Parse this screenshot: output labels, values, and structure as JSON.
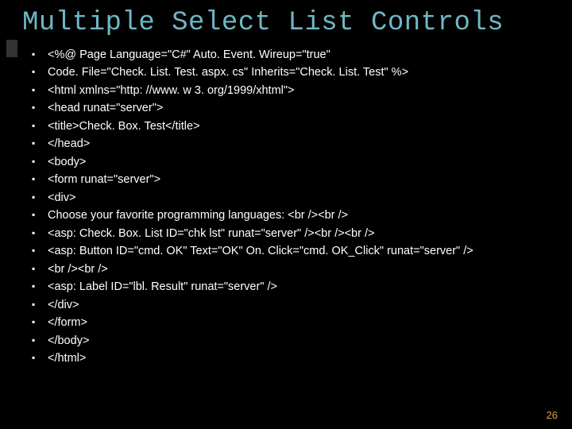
{
  "title": "Multiple Select List Controls",
  "lines": [
    "<%@ Page Language=\"C#\" Auto. Event. Wireup=\"true\"",
    "Code. File=\"Check. List. Test. aspx. cs\" Inherits=\"Check. List. Test\" %>",
    "<html xmlns=\"http: //www. w 3. org/1999/xhtml\">",
    "<head runat=\"server\">",
    "<title>Check. Box. Test</title>",
    "</head>",
    "<body>",
    "<form runat=\"server\">",
    "<div>",
    "Choose your favorite programming languages: <br /><br />",
    "<asp: Check. Box. List ID=\"chk lst\" runat=\"server\" /><br /><br />",
    "<asp: Button ID=\"cmd. OK\" Text=\"OK\" On. Click=\"cmd. OK_Click\" runat=\"server\" />",
    "<br /><br />",
    "<asp: Label ID=\"lbl. Result\" runat=\"server\" />",
    "</div>",
    "</form>",
    "</body>",
    "</html>"
  ],
  "page_number": "26"
}
